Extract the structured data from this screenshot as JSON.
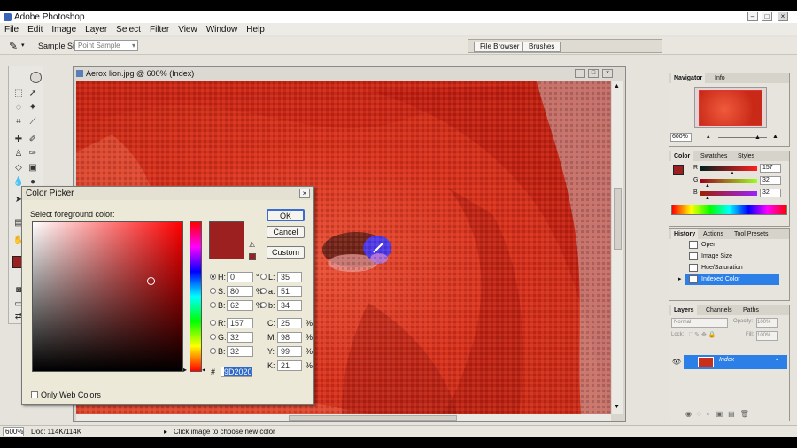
{
  "app": {
    "title": "Adobe Photoshop"
  },
  "menu": [
    "File",
    "Edit",
    "Image",
    "Layer",
    "Select",
    "Filter",
    "View",
    "Window",
    "Help"
  ],
  "options": {
    "sample_label": "Sample Size:",
    "sample_value": "Point Sample",
    "well_tabs": [
      "File Browser",
      "Brushes"
    ]
  },
  "document": {
    "title": "Aerox lion.jpg @ 600% (Index)"
  },
  "color_picker": {
    "title": "Color Picker",
    "prompt": "Select foreground color:",
    "ok": "OK",
    "cancel": "Cancel",
    "custom": "Custom",
    "hsb": [
      {
        "label": "H:",
        "value": "0",
        "unit": "°"
      },
      {
        "label": "S:",
        "value": "80",
        "unit": "%"
      },
      {
        "label": "B:",
        "value": "62",
        "unit": "%"
      }
    ],
    "rgb": [
      {
        "label": "R:",
        "value": "157"
      },
      {
        "label": "G:",
        "value": "32"
      },
      {
        "label": "B:",
        "value": "32"
      }
    ],
    "lab": [
      {
        "label": "L:",
        "value": "35"
      },
      {
        "label": "a:",
        "value": "51"
      },
      {
        "label": "b:",
        "value": "34"
      }
    ],
    "cmyk": [
      {
        "label": "C:",
        "value": "25",
        "unit": "%"
      },
      {
        "label": "M:",
        "value": "98",
        "unit": "%"
      },
      {
        "label": "Y:",
        "value": "99",
        "unit": "%"
      },
      {
        "label": "K:",
        "value": "21",
        "unit": "%"
      }
    ],
    "hex_prefix": "#",
    "hex": "9D2020",
    "web_only": "Only Web Colors",
    "selected_color": "#9d2020"
  },
  "navigator": {
    "tabs": [
      "Navigator",
      "Info"
    ],
    "zoom": "600%"
  },
  "color_panel": {
    "tabs": [
      "Color",
      "Swatches",
      "Styles"
    ],
    "channels": [
      {
        "label": "R",
        "value": "157"
      },
      {
        "label": "G",
        "value": "32"
      },
      {
        "label": "B",
        "value": "32"
      }
    ]
  },
  "history": {
    "tabs": [
      "History",
      "Actions",
      "Tool Presets"
    ],
    "items": [
      "Open",
      "Image Size",
      "Hue/Saturation",
      "Indexed Color"
    ]
  },
  "layers": {
    "tabs": [
      "Layers",
      "Channels",
      "Paths"
    ],
    "mode": "Normal",
    "opacity_label": "Opacity:",
    "opacity": "100%",
    "lock_label": "Lock:",
    "fill_label": "Fill:",
    "fill": "100%",
    "layer_name": "Index"
  },
  "status": {
    "zoom": "600%",
    "doc": "Doc: 114K/114K",
    "hint": "Click image to choose new color"
  }
}
